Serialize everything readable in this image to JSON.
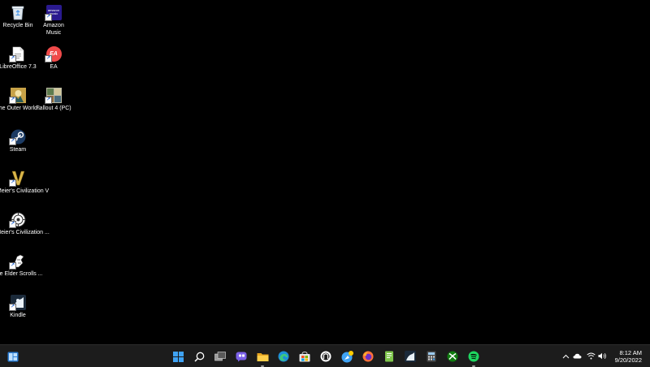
{
  "desktop": {
    "icons": [
      {
        "label": "Recycle Bin",
        "icon": "recycle-bin-icon"
      },
      {
        "label": "Amazon Music",
        "icon": "amazon-music-icon",
        "icon_text": "amazon music"
      },
      {
        "label": "LibreOffice 7.3",
        "icon": "libreoffice-icon"
      },
      {
        "label": "EA",
        "icon": "ea-icon",
        "icon_text": "EA"
      },
      {
        "label": "The Outer Worlds",
        "icon": "outer-worlds-icon"
      },
      {
        "label": "Fallout 4 (PC)",
        "icon": "fallout-4-icon"
      },
      {
        "label": "Steam",
        "icon": "steam-icon"
      },
      {
        "label": "Sid Meier's Civilization V",
        "icon": "civilization-v-icon",
        "icon_text": "V"
      },
      {
        "label": "Sid Meier's Civilization ...",
        "icon": "civilization-vi-icon"
      },
      {
        "label": "The Elder Scrolls ...",
        "icon": "elder-scrolls-icon"
      },
      {
        "label": "Kindle",
        "icon": "kindle-icon"
      }
    ]
  },
  "taskbar": {
    "apps": [
      {
        "name": "start",
        "icon": "windows-start-icon"
      },
      {
        "name": "search",
        "icon": "search-icon"
      },
      {
        "name": "task-view",
        "icon": "task-view-icon"
      },
      {
        "name": "chat",
        "icon": "chat-icon"
      },
      {
        "name": "file-explorer",
        "icon": "file-explorer-icon"
      },
      {
        "name": "edge",
        "icon": "edge-icon"
      },
      {
        "name": "microsoft-store",
        "icon": "store-icon"
      },
      {
        "name": "app-circle",
        "icon": "app-circle-icon"
      },
      {
        "name": "app-compass",
        "icon": "compass-icon"
      },
      {
        "name": "firefox",
        "icon": "firefox-icon"
      },
      {
        "name": "notepad-plus",
        "icon": "notepad-icon"
      },
      {
        "name": "kindle",
        "icon": "kindle-icon"
      },
      {
        "name": "calculator",
        "icon": "calculator-icon"
      },
      {
        "name": "xbox",
        "icon": "xbox-icon"
      },
      {
        "name": "spotify",
        "icon": "spotify-icon"
      }
    ],
    "tray": {
      "icons": [
        "chevron-up-icon",
        "onedrive-icon",
        "wifi-icon",
        "volume-icon"
      ],
      "time": "8:12 AM",
      "date": "9/20/2022"
    }
  }
}
